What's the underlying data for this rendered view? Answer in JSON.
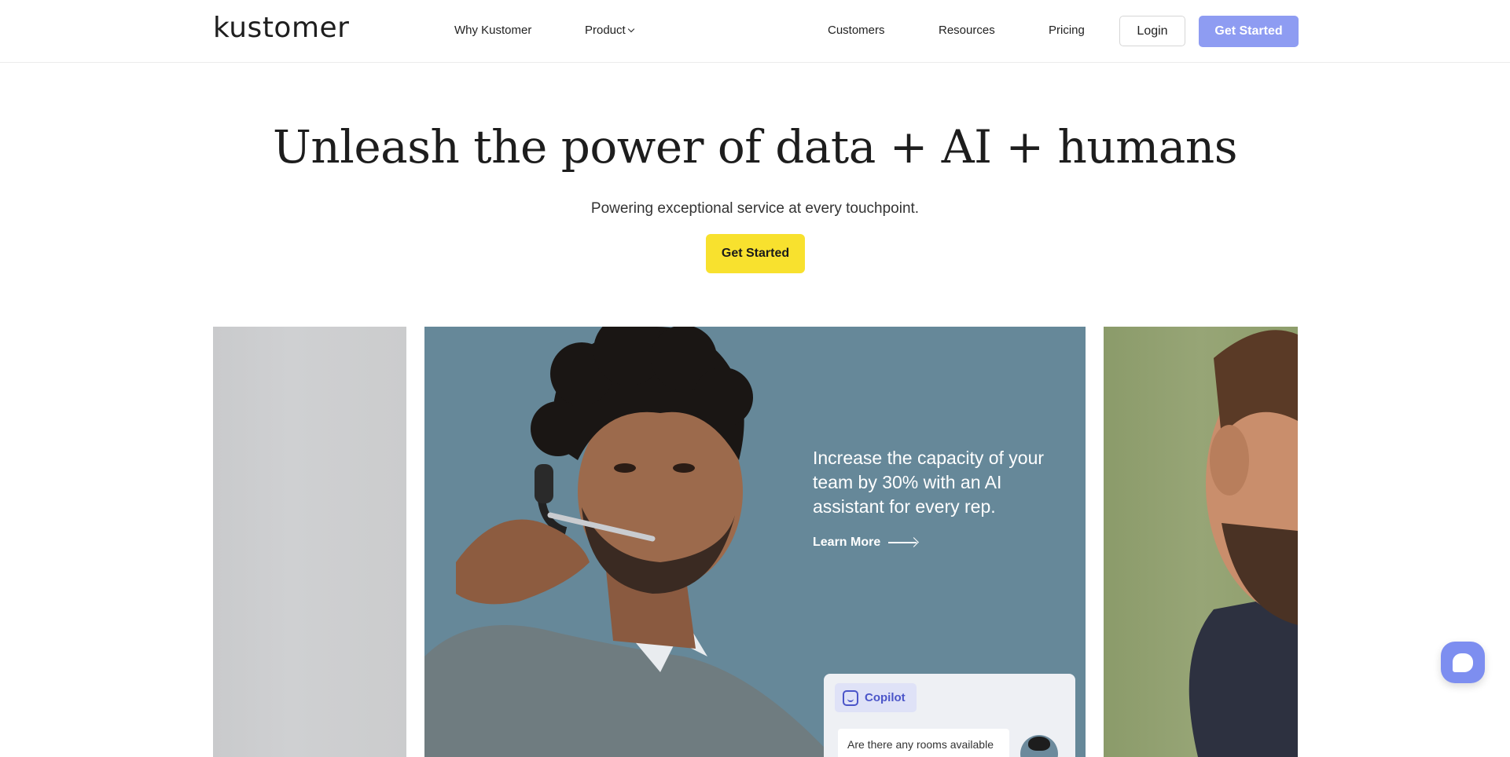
{
  "header": {
    "logo": "kustomer",
    "nav": {
      "why": "Why Kustomer",
      "product": "Product",
      "customers": "Customers",
      "resources": "Resources",
      "pricing": "Pricing"
    },
    "login_label": "Login",
    "get_started_label": "Get Started"
  },
  "hero": {
    "title": "Unleash the power of data + AI + humans",
    "subtitle": "Powering exceptional service at every touchpoint.",
    "cta_label": "Get Started"
  },
  "carousel": {
    "active_slide": {
      "text": "Increase the capacity of your team by 30% with an AI assistant for every rep.",
      "link_label": "Learn More",
      "copilot": {
        "badge_label": "Copilot",
        "question": "Are there any rooms available"
      }
    }
  },
  "colors": {
    "accent": "#8e9cf2",
    "cta_yellow": "#f8e12e",
    "slide_bg": "#668899"
  }
}
